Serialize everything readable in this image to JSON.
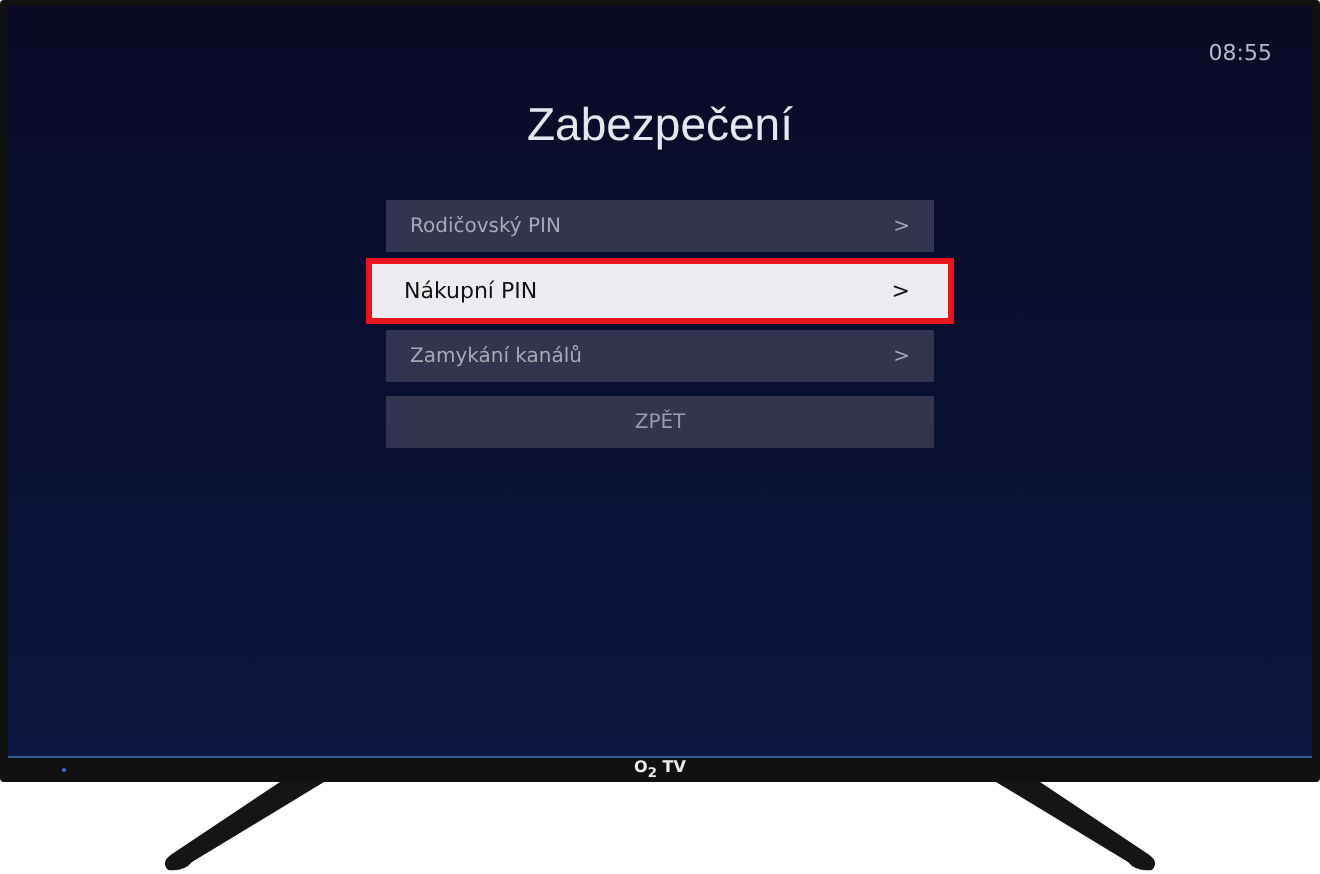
{
  "screen": {
    "clock": "08:55",
    "title": "Zabezpečení",
    "menu": [
      {
        "label": "Rodičovský PIN",
        "chevron": ">",
        "selected": false
      },
      {
        "label": "Nákupní PIN",
        "chevron": ">",
        "selected": true
      },
      {
        "label": "Zamykání kanálů",
        "chevron": ">",
        "selected": false
      }
    ],
    "back_button": "ZPĚT"
  },
  "tv": {
    "brand": "O$_{2}$ TV"
  }
}
